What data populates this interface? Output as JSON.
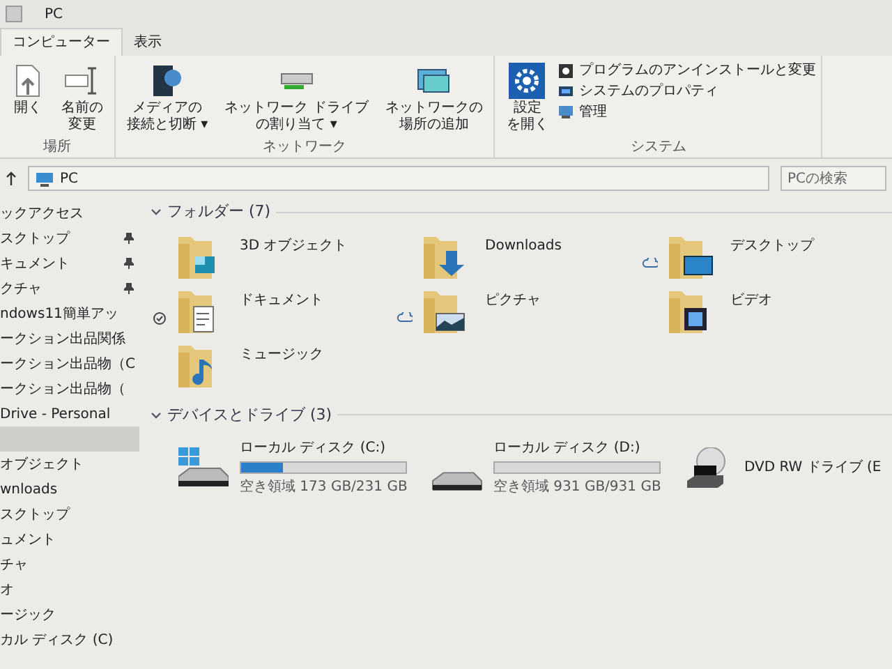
{
  "window": {
    "title": "PC"
  },
  "tabs": [
    {
      "label": "コンピューター",
      "selected": true
    },
    {
      "label": "表示",
      "selected": false
    }
  ],
  "ribbon_groups": [
    {
      "label": "場所",
      "items": [
        {
          "kind": "large",
          "lines": [
            "開く"
          ]
        },
        {
          "kind": "large",
          "lines": [
            "名前の",
            "変更"
          ]
        }
      ]
    },
    {
      "label": "ネットワーク",
      "items": [
        {
          "kind": "large",
          "lines": [
            "メディアの",
            "接続と切断 ▾"
          ]
        },
        {
          "kind": "large",
          "lines": [
            "ネットワーク ドライブ",
            "の割り当て ▾"
          ]
        },
        {
          "kind": "large",
          "lines": [
            "ネットワークの",
            "場所の追加"
          ]
        }
      ]
    },
    {
      "label": "システム",
      "items": [
        {
          "kind": "large",
          "lines": [
            "設定",
            "を開く"
          ]
        },
        {
          "kind": "small",
          "lines": [
            "プログラムのアンインストールと変更"
          ]
        },
        {
          "kind": "small",
          "lines": [
            "システムのプロパティ"
          ]
        },
        {
          "kind": "small",
          "lines": [
            "管理"
          ]
        }
      ]
    }
  ],
  "address_bar": {
    "path": "PC",
    "search_placeholder": "PCの検索"
  },
  "sidebar": {
    "items": [
      {
        "label": "ックアクセス",
        "pinned": false,
        "selected": false
      },
      {
        "label": "スクトップ",
        "pinned": true,
        "selected": false
      },
      {
        "label": "キュメント",
        "pinned": true,
        "selected": false
      },
      {
        "label": "クチャ",
        "pinned": true,
        "selected": false
      },
      {
        "label": "ndows11簡単アッ",
        "pinned": false,
        "selected": false
      },
      {
        "label": "ークション出品関係",
        "pinned": false,
        "selected": false
      },
      {
        "label": "ークション出品物（C",
        "pinned": false,
        "selected": false
      },
      {
        "label": "ークション出品物（",
        "pinned": false,
        "selected": false
      },
      {
        "label": "Drive - Personal",
        "pinned": false,
        "selected": false
      },
      {
        "pinned": false,
        "selected": true
      },
      {
        "label": "オブジェクト",
        "pinned": false,
        "selected": false
      },
      {
        "label": "wnloads",
        "pinned": false,
        "selected": false
      },
      {
        "label": "スクトップ",
        "pinned": false,
        "selected": false
      },
      {
        "label": "ュメント",
        "pinned": false,
        "selected": false
      },
      {
        "label": "チャ",
        "pinned": false,
        "selected": false
      },
      {
        "label": "オ",
        "pinned": false,
        "selected": false
      },
      {
        "label": "ージック",
        "pinned": false,
        "selected": false
      },
      {
        "label": "カル ディスク (C)",
        "pinned": false,
        "selected": false
      }
    ]
  },
  "folders": {
    "heading": "フォルダー (7)",
    "expanded": true,
    "items": [
      {
        "name": "3D オブジェクト",
        "cloud": false,
        "synced": false
      },
      {
        "name": "Downloads",
        "cloud": false,
        "synced": false
      },
      {
        "name": "デスクトップ",
        "cloud": true,
        "synced": false
      },
      {
        "name": "ドキュメント",
        "cloud": false,
        "synced": true
      },
      {
        "name": "ピクチャ",
        "cloud": true,
        "synced": false
      },
      {
        "name": "ビデオ",
        "cloud": false,
        "synced": false
      },
      {
        "name": "ミュージック",
        "cloud": false,
        "synced": false
      }
    ]
  },
  "drives": {
    "heading": "デバイスとドライブ (3)",
    "expanded": true,
    "items": [
      {
        "kind": "disk",
        "name": "ローカル ディスク (C:)",
        "system": true,
        "level": 0.25,
        "free": "空き領域 173 GB/231 GB"
      },
      {
        "kind": "disk",
        "name": "ローカル ディスク (D:)",
        "system": false,
        "level": 0,
        "free": "空き領域 931 GB/931 GB"
      },
      {
        "kind": "dvd",
        "name": "DVD RW ドライブ (E"
      }
    ]
  }
}
